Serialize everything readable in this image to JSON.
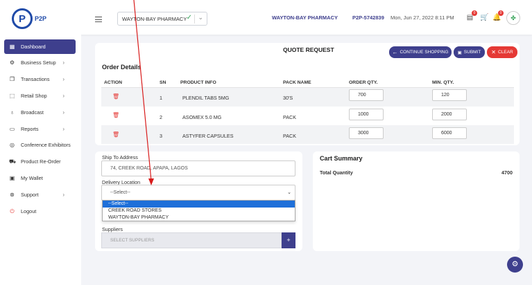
{
  "brand": {
    "logo_letter": "P",
    "name": "P2P"
  },
  "topbar": {
    "pharmacy_select": "WAYTON-BAY PHARMACY",
    "pharmacy_name": "WAYTON-BAY PHARMACY",
    "code": "P2P-5742839",
    "date": "Mon, Jun 27, 2022 8:11 PM",
    "badges": {
      "messages": "0",
      "cart": "",
      "notifications": "0"
    }
  },
  "sidebar": {
    "items": [
      {
        "label": "Dashboard",
        "icon": "grid-icon"
      },
      {
        "label": "Business Setup",
        "icon": "gear-icon"
      },
      {
        "label": "Transactions",
        "icon": "copy-icon"
      },
      {
        "label": "Retail Shop",
        "icon": "shop-icon"
      },
      {
        "label": "Broadcast",
        "icon": "mic-icon"
      },
      {
        "label": "Reports",
        "icon": "folder-icon"
      },
      {
        "label": "Conference Exhibitors",
        "icon": "target-icon"
      },
      {
        "label": "Product Re-Order",
        "icon": "cart-icon"
      },
      {
        "label": "My Wallet",
        "icon": "wallet-icon"
      },
      {
        "label": "Support",
        "icon": "support-icon"
      },
      {
        "label": "Logout",
        "icon": "power-icon"
      }
    ]
  },
  "quote": {
    "title": "QUOTE REQUEST",
    "continue_label": "CONTINUE SHOPPING",
    "submit_label": "SUBMIT",
    "clear_label": "CLEAR"
  },
  "order": {
    "title": "Order Details",
    "headers": [
      "ACTION",
      "SN",
      "PRODUCT INFO",
      "PACK NAME",
      "ORDER QTY.",
      "MIN. QTY."
    ],
    "rows": [
      {
        "sn": "1",
        "product": "PLENDIL TABS 5MG",
        "pack": "30'S",
        "order_qty": "700",
        "min_qty": "120"
      },
      {
        "sn": "2",
        "product": "ASOMEX 5.0 MG",
        "pack": "PACK",
        "order_qty": "1000",
        "min_qty": "2000"
      },
      {
        "sn": "3",
        "product": "ASTYFER CAPSULES",
        "pack": "PACK",
        "order_qty": "3000",
        "min_qty": "6000"
      }
    ]
  },
  "shipping": {
    "address_label": "Ship To Address",
    "address_value": "74, CREEK ROAD, APAPA, LAGOS",
    "location_label": "Delivery Location",
    "location_value": "--Select--",
    "options": [
      "--Select--",
      "CREEK ROAD STORES",
      "WAYTON-BAY PHARMACY"
    ],
    "suppliers_label": "Suppliers",
    "suppliers_placeholder": "SELECT SUPPLIERS",
    "add_label": "+"
  },
  "cart": {
    "title": "Cart Summary",
    "total_label": "Total Quantity",
    "total_value": "4700"
  },
  "colors": {
    "primary": "#3e3f8d",
    "danger": "#e53935",
    "highlight": "#1e6fd9"
  }
}
